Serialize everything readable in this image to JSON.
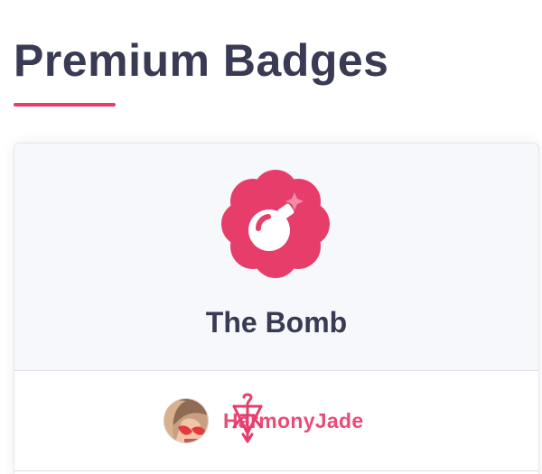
{
  "header": {
    "title": "Premium Badges"
  },
  "badge": {
    "name": "The Bomb",
    "icon": "bomb-flower-icon"
  },
  "user": {
    "username": "HarmonyJade",
    "avatar": "user-avatar",
    "overlay_icon": "cupid-bow-arrow-icon"
  },
  "colors": {
    "accent": "#e63d6b",
    "title_text": "#383b53",
    "username_text": "#e84c77",
    "card_top_background": "#f7f8fb"
  }
}
